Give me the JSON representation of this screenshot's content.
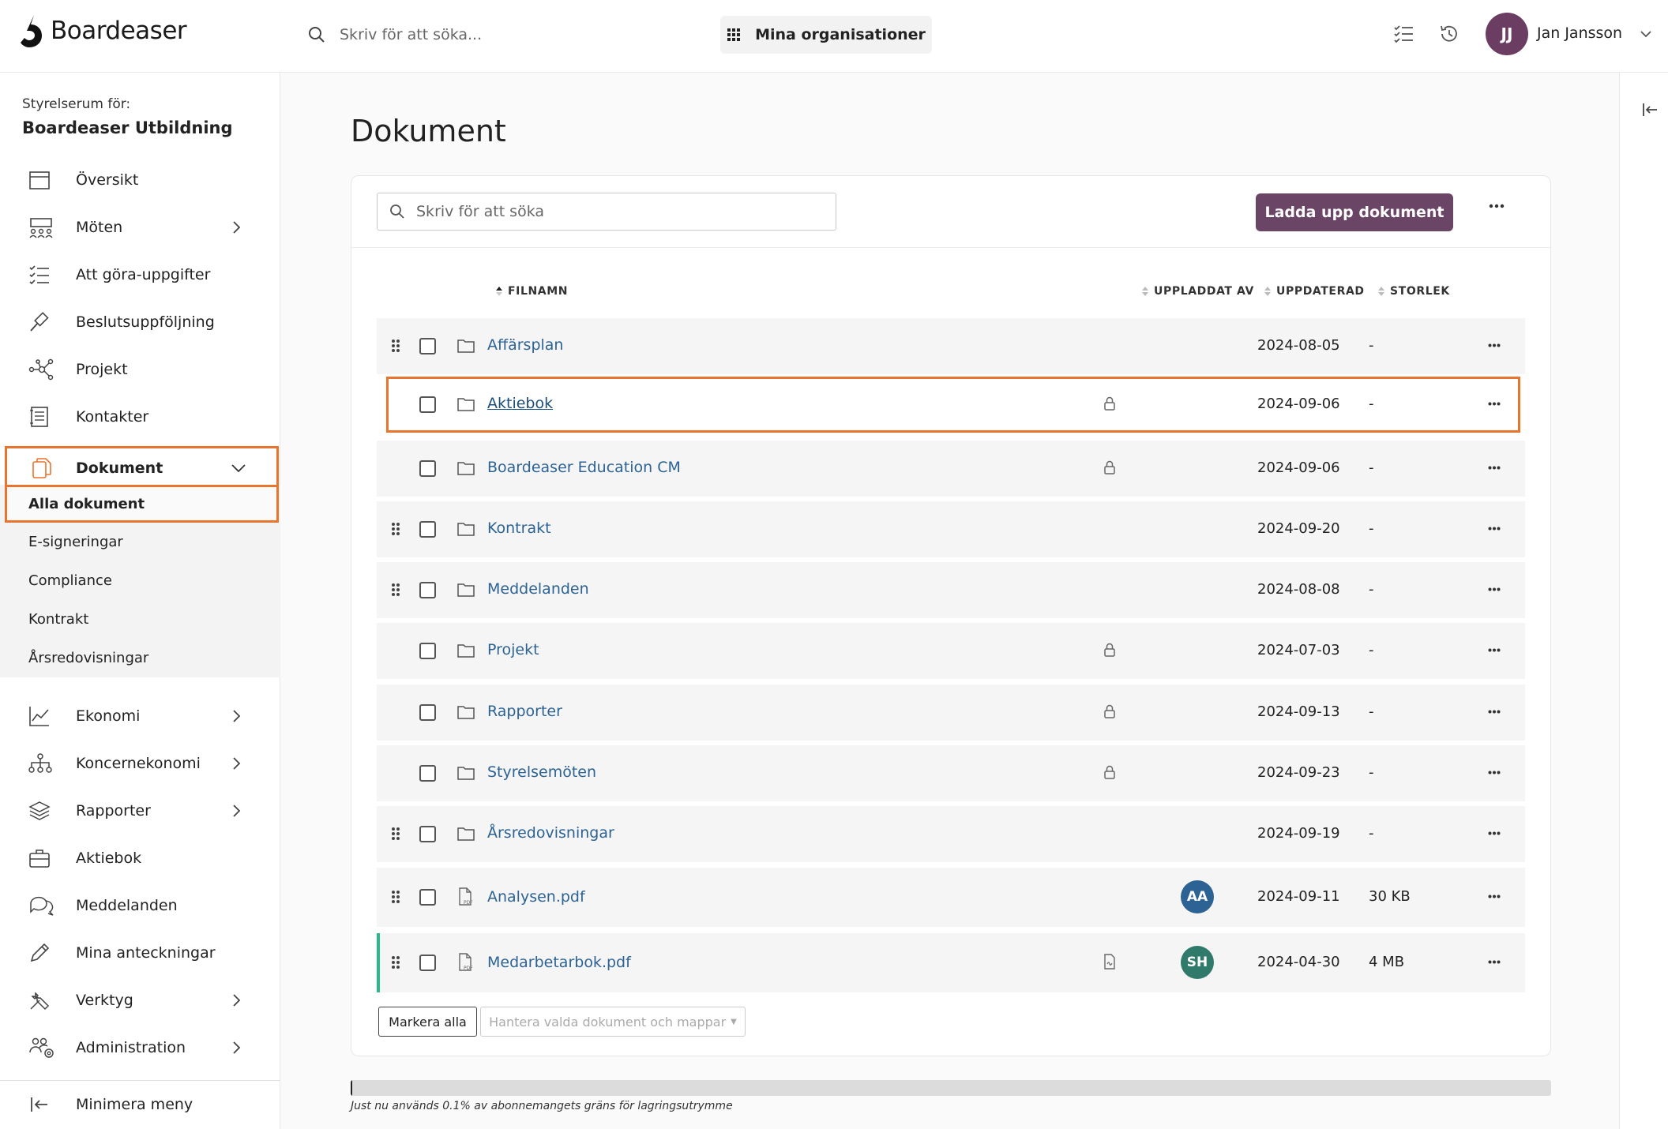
{
  "app": {
    "logo_text": "Boardeaser"
  },
  "topbar": {
    "search_placeholder": "Skriv för att söka...",
    "org_button": "Mina organisationer",
    "user_initials": "JJ",
    "user_name": "Jan Jansson",
    "avatar_color": "#6b3d63"
  },
  "sidebar": {
    "for_label": "Styrelserum för:",
    "org_name": "Boardeaser Utbildning",
    "items": [
      {
        "label": "Översikt",
        "icon": "calendar-icon"
      },
      {
        "label": "Möten",
        "icon": "meeting-icon"
      },
      {
        "label": "Att göra-uppgifter",
        "icon": "checklist-icon"
      },
      {
        "label": "Beslutsuppföljning",
        "icon": "gavel-icon"
      },
      {
        "label": "Projekt",
        "icon": "network-icon"
      },
      {
        "label": "Kontakter",
        "icon": "contacts-icon"
      },
      {
        "label": "Dokument",
        "icon": "documents-icon"
      },
      {
        "label": "Ekonomi",
        "icon": "chart-icon"
      },
      {
        "label": "Koncernekonomi",
        "icon": "hierarchy-icon"
      },
      {
        "label": "Rapporter",
        "icon": "layers-icon"
      },
      {
        "label": "Aktiebok",
        "icon": "briefcase-icon"
      },
      {
        "label": "Meddelanden",
        "icon": "chat-icon"
      },
      {
        "label": "Mina anteckningar",
        "icon": "pencil-icon"
      },
      {
        "label": "Verktyg",
        "icon": "tools-icon"
      },
      {
        "label": "Administration",
        "icon": "users-gear-icon"
      }
    ],
    "sub_items": [
      "Alla dokument",
      "E-signeringar",
      "Compliance",
      "Kontrakt",
      "Årsredovisningar"
    ],
    "minimize": "Minimera meny",
    "accent_color": "#e8742e"
  },
  "main": {
    "title": "Dokument",
    "search_placeholder": "Skriv för att söka",
    "upload_button": "Ladda upp dokument",
    "columns": {
      "filename": "FILNAMN",
      "uploaded_by": "UPPLADDAT AV",
      "updated": "UPPDATERAD",
      "size": "STORLEK"
    },
    "rows": [
      {
        "name": "Affärsplan",
        "type": "folder",
        "date": "2024-08-05",
        "size": "-",
        "drag": true,
        "locked": false
      },
      {
        "name": "Aktiebok",
        "type": "folder",
        "date": "2024-09-06",
        "size": "-",
        "drag": false,
        "locked": true
      },
      {
        "name": "Boardeaser Education CM",
        "type": "folder",
        "date": "2024-09-06",
        "size": "-",
        "drag": false,
        "locked": true
      },
      {
        "name": "Kontrakt",
        "type": "folder",
        "date": "2024-09-20",
        "size": "-",
        "drag": true,
        "locked": false
      },
      {
        "name": "Meddelanden",
        "type": "folder",
        "date": "2024-08-08",
        "size": "-",
        "drag": true,
        "locked": false
      },
      {
        "name": "Projekt",
        "type": "folder",
        "date": "2024-07-03",
        "size": "-",
        "drag": false,
        "locked": true
      },
      {
        "name": "Rapporter",
        "type": "folder",
        "date": "2024-09-13",
        "size": "-",
        "drag": false,
        "locked": true
      },
      {
        "name": "Styrelsemöten",
        "type": "folder",
        "date": "2024-09-23",
        "size": "-",
        "drag": false,
        "locked": true
      },
      {
        "name": "Årsredovisningar",
        "type": "folder",
        "date": "2024-09-19",
        "size": "-",
        "drag": true,
        "locked": false
      },
      {
        "name": "Analysen.pdf",
        "type": "pdf",
        "uploader": "AA",
        "uploader_color": "#2d6394",
        "date": "2024-09-11",
        "size": "30 KB",
        "drag": true,
        "locked": false
      },
      {
        "name": "Medarbetarbok.pdf",
        "type": "pdf",
        "uploader": "SH",
        "uploader_color": "#2f7a6b",
        "date": "2024-04-30",
        "size": "4 MB",
        "drag": true,
        "locked": false
      }
    ],
    "select_all": "Markera alla",
    "manage_selected": "Hantera valda dokument och mappar",
    "storage_used_fraction": 0.001,
    "storage_text": "Just nu används 0.1% av abonnemangets gräns för lagringsutrymme"
  }
}
